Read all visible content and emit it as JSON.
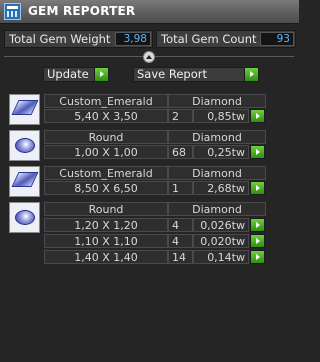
{
  "window": {
    "title": "GEM REPORTER"
  },
  "summary": {
    "total_weight_label": "Total Gem Weight",
    "total_weight_value": "3,98",
    "total_count_label": "Total Gem Count",
    "total_count_value": "93"
  },
  "actions": {
    "update_label": "Update",
    "save_label": "Save Report"
  },
  "groups": [
    {
      "shape": "Custom_Emerald",
      "material": "Diamond",
      "icon": "emerald-gem-icon",
      "rows": [
        {
          "size": "5,40 X 3,50",
          "count": "2",
          "weight": "0,85tw"
        }
      ]
    },
    {
      "shape": "Round",
      "material": "Diamond",
      "icon": "round-gem-icon",
      "rows": [
        {
          "size": "1,00 X 1,00",
          "count": "68",
          "weight": "0,25tw"
        }
      ]
    },
    {
      "shape": "Custom_Emerald",
      "material": "Diamond",
      "icon": "emerald-gem-icon",
      "rows": [
        {
          "size": "8,50 X 6,50",
          "count": "1",
          "weight": "2,68tw"
        }
      ]
    },
    {
      "shape": "Round",
      "material": "Diamond",
      "icon": "round-gem-icon",
      "rows": [
        {
          "size": "1,20 X 1,20",
          "count": "4",
          "weight": "0,026tw"
        },
        {
          "size": "1,10 X 1,10",
          "count": "4",
          "weight": "0,020tw"
        },
        {
          "size": "1,40 X 1,40",
          "count": "14",
          "weight": "0,14tw"
        }
      ]
    }
  ],
  "colors": {
    "value_text": "#59b8ff",
    "action_green": "#4caf28",
    "background": "#252525"
  }
}
